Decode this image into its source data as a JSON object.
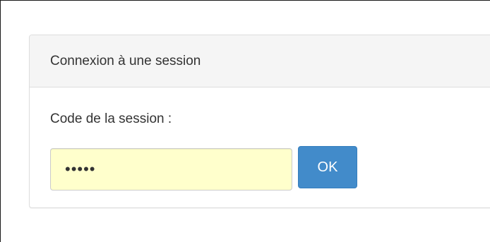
{
  "panel": {
    "title": "Connexion à une session"
  },
  "form": {
    "label": "Code de la session :",
    "code_value": "•••••",
    "ok_label": "OK"
  },
  "colors": {
    "input_background": "#ffffcc",
    "button_primary": "#428bca",
    "panel_heading_bg": "#f5f5f5"
  }
}
